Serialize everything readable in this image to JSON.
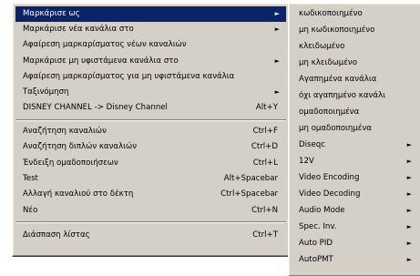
{
  "main_menu": {
    "items": [
      {
        "label": "Μαρκάρισε ως",
        "shortcut": "",
        "submenu": true,
        "selected": true
      },
      {
        "label": "Μαρκάρισε νέα κανάλια στο",
        "shortcut": "",
        "submenu": true
      },
      {
        "label": "Αφαίρεση μαρκαρίσματος νέων καναλιών",
        "shortcut": "",
        "submenu": false
      },
      {
        "label": "Μαρκάρισε μη υφιστάμενα κανάλια στο",
        "shortcut": "",
        "submenu": true
      },
      {
        "label": "Αφαίρεση μαρκαρίσματος για μη υφιστάμενα κανάλια",
        "shortcut": "",
        "submenu": false
      },
      {
        "label": "Ταξινόμηση",
        "shortcut": "",
        "submenu": true
      },
      {
        "label": "DISNEY CHANNEL -> Disney Channel",
        "shortcut": "Alt+Y",
        "submenu": false
      },
      {
        "label": "Αναζήτηση καναλιών",
        "shortcut": "Ctrl+F",
        "submenu": false
      },
      {
        "label": "Αναζήτηση διπλών καναλιών",
        "shortcut": "Ctrl+D",
        "submenu": false
      },
      {
        "label": "Ένδειξη ομαδοποιήσεων",
        "shortcut": "Ctrl+L",
        "submenu": false
      },
      {
        "label": "Test",
        "shortcut": "Alt+Spacebar",
        "submenu": false
      },
      {
        "label": "Αλλαγή καναλιού στο δέκτη",
        "shortcut": "Ctrl+Spacebar",
        "submenu": false
      },
      {
        "label": "Νέο",
        "shortcut": "Ctrl+N",
        "submenu": false
      },
      {
        "label": "Διάσπαση λίστας",
        "shortcut": "Ctrl+T",
        "submenu": false
      }
    ]
  },
  "sub_menu": {
    "items": [
      {
        "label": "κωδικοποιημένο",
        "submenu": false
      },
      {
        "label": "μη κωδικοποιημένο",
        "submenu": false
      },
      {
        "label": "κλειδωμένο",
        "submenu": false
      },
      {
        "label": "μη κλειδωμένο",
        "submenu": false
      },
      {
        "label": "Αγαπημένα κανάλια",
        "submenu": false
      },
      {
        "label": "όχι αγαπημένο κανάλι",
        "submenu": false
      },
      {
        "label": "ομαδοποιημένα",
        "submenu": false
      },
      {
        "label": "μη ομαδοποιημένα",
        "submenu": false
      },
      {
        "label": "Diseqc",
        "submenu": true
      },
      {
        "label": "12V",
        "submenu": true
      },
      {
        "label": "Video Encoding",
        "submenu": true
      },
      {
        "label": "Video Decoding",
        "submenu": true
      },
      {
        "label": "Audio Mode",
        "submenu": true
      },
      {
        "label": "Spec. Inv.",
        "submenu": true
      },
      {
        "label": "Auto PID",
        "submenu": true
      },
      {
        "label": "AutoPMT",
        "submenu": true
      }
    ]
  },
  "colors": {
    "menu_bg": "#d4d0c8",
    "highlight": "#0a246a",
    "highlight_text": "#ffffff"
  },
  "icons": {
    "submenu_arrow": "triangle-right-icon"
  }
}
